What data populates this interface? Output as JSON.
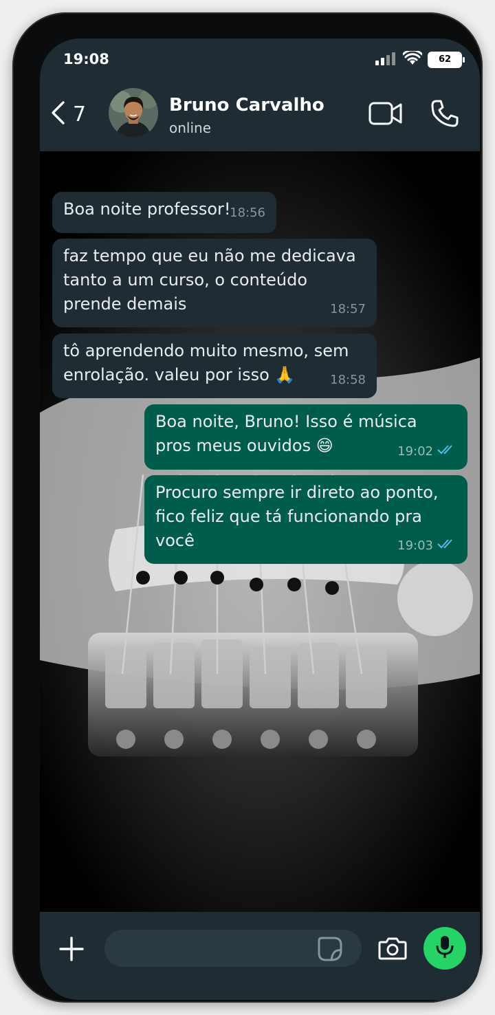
{
  "status_bar": {
    "time": "19:08",
    "battery": "62"
  },
  "header": {
    "back_count": "7",
    "contact_name": "Bruno Carvalho",
    "contact_status": "online"
  },
  "messages": [
    {
      "direction": "in",
      "text": "Boa noite professor!",
      "time": "18:56"
    },
    {
      "direction": "in",
      "text": "faz tempo que eu não me dedicava tanto a um curso, o conteúdo prende demais",
      "time": "18:57"
    },
    {
      "direction": "in",
      "text": "tô aprendendo muito mesmo, sem enrolação. valeu por isso 🙏",
      "time": "18:58"
    },
    {
      "direction": "out",
      "text": "Boa noite, Bruno! Isso é música pros meus ouvidos 😄",
      "time": "19:02",
      "status": "read"
    },
    {
      "direction": "out",
      "text": "Procuro sempre ir direto ao ponto, fico feliz que tá funcionando pra você",
      "time": "19:03",
      "status": "read"
    }
  ],
  "input": {
    "placeholder": "",
    "value": ""
  },
  "colors": {
    "header_bg": "#1f2c34",
    "incoming_bubble": "#1f2c34",
    "outgoing_bubble": "#005c4b",
    "mic_button": "#25d366",
    "read_tick": "#53bdeb"
  },
  "icons": [
    "back-icon",
    "video-call-icon",
    "phone-icon",
    "plus-icon",
    "sticker-icon",
    "camera-icon",
    "mic-icon",
    "signal-icon",
    "wifi-icon",
    "battery-icon",
    "double-check-icon"
  ]
}
